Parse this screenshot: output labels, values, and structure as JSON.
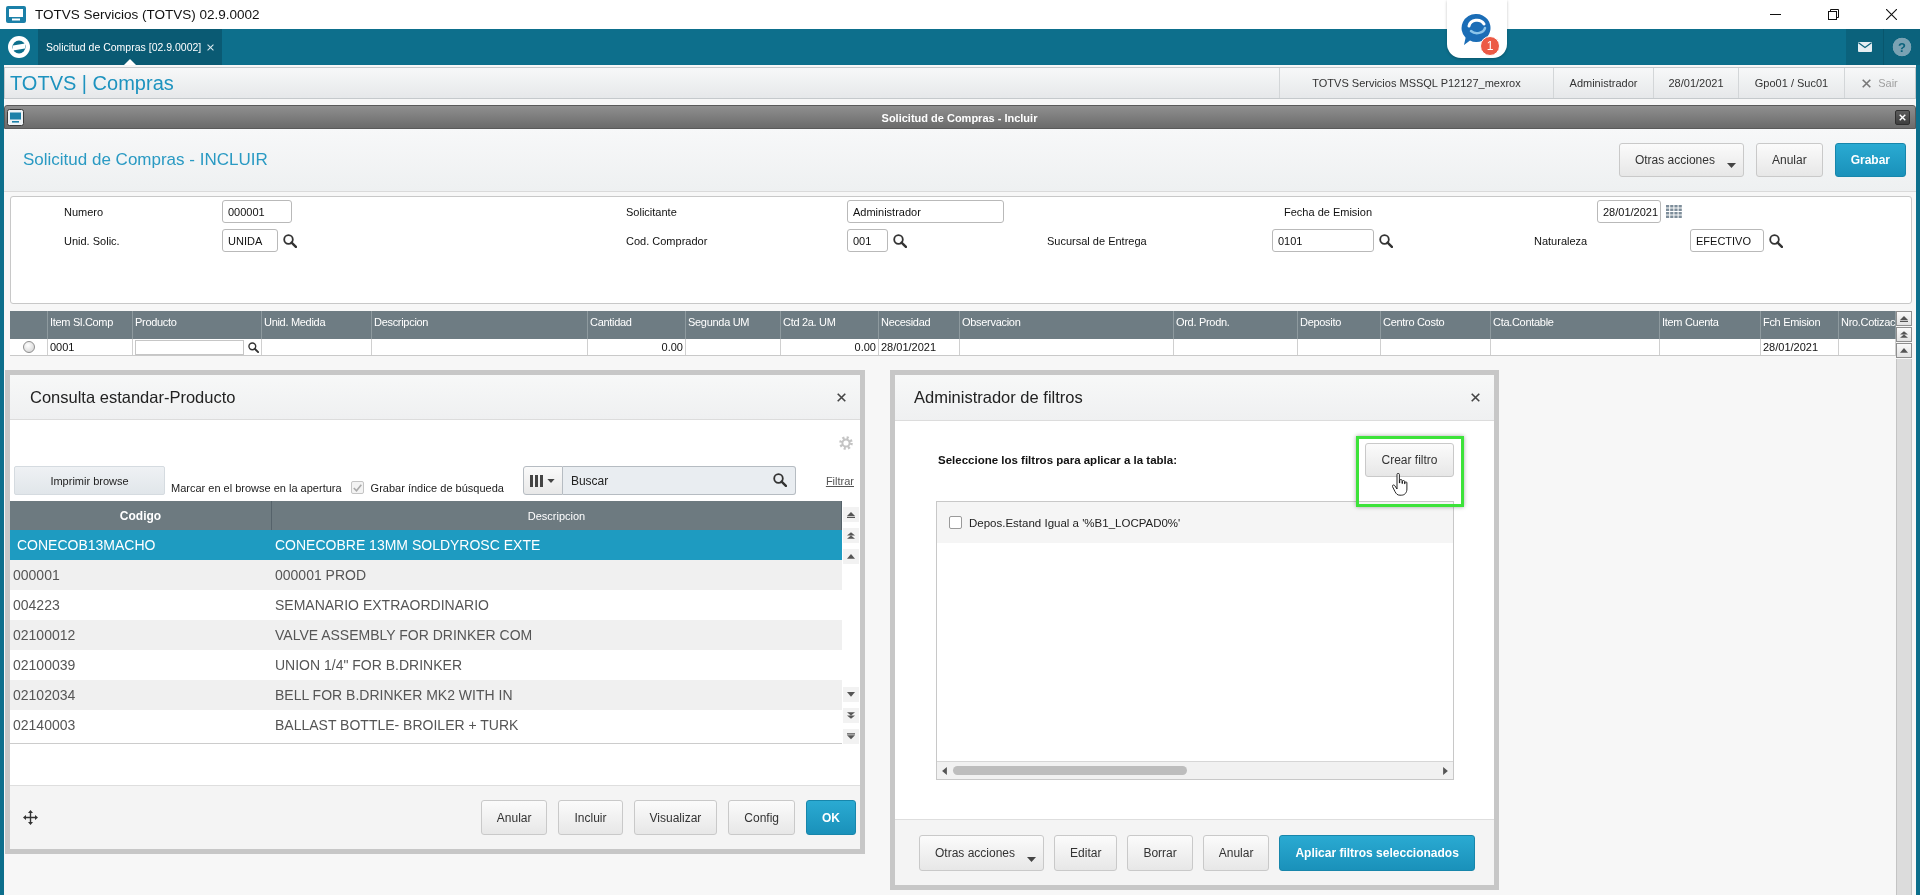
{
  "window": {
    "title": "TOTVS Servicios (TOTVS) 02.9.0002"
  },
  "tab_bar": {
    "tabs": [
      {
        "label": "Solicitud de Compras [02.9.0002]",
        "selected": true
      }
    ],
    "notification_badge": "1",
    "help_button": "?"
  },
  "app_header": {
    "title": "TOTVS | Compras",
    "info": [
      "TOTVS Servicios MSSQL P12127_mexrox",
      "Administrador",
      "28/01/2021",
      "Gpo01 / Suc01"
    ],
    "logout": "Sair"
  },
  "main_window": {
    "title": "Solicitud de Compras - Incluir",
    "heading": "Solicitud de Compras - INCLUIR",
    "buttons": [
      {
        "label": "Otras acciones",
        "kind": "menu"
      },
      {
        "label": "Anular",
        "kind": "plain"
      },
      {
        "label": "Grabar",
        "kind": "primary"
      }
    ]
  },
  "form": {
    "rows": [
      [
        {
          "label": "Numero",
          "value": "000001",
          "kind": "text"
        },
        {
          "label": "Solicitante",
          "value": "Administrador",
          "kind": "text"
        },
        {
          "label": "Fecha de Emision",
          "value": "28/01/2021",
          "kind": "date"
        }
      ],
      [
        {
          "label": "Unid. Solic.",
          "value": "UNIDA",
          "kind": "lookup"
        },
        {
          "label": "Cod. Comprador",
          "value": "001",
          "kind": "lookup"
        },
        {
          "label": "Sucursal de Entrega",
          "value": "0101",
          "kind": "lookup"
        },
        {
          "label": "Naturaleza",
          "value": "EFECTIVO",
          "kind": "lookup"
        }
      ]
    ]
  },
  "grid": {
    "row_selected": false,
    "columns": [
      {
        "heading": "Item Sl.Comp",
        "kind": "text",
        "cell": "0001"
      },
      {
        "heading": "Producto",
        "kind": "lookup"
      },
      {
        "heading": "Unid. Medida",
        "kind": "text"
      },
      {
        "heading": "Descripcion",
        "kind": "text"
      },
      {
        "heading": "Cantidad",
        "kind": "number",
        "cell": "0.00"
      },
      {
        "heading": "Segunda UM",
        "kind": "text"
      },
      {
        "heading": "Ctd 2a. UM",
        "kind": "number",
        "cell": "0.00"
      },
      {
        "heading": "Necesidad",
        "kind": "text",
        "cell": "28/01/2021"
      },
      {
        "heading": "Observacion",
        "kind": "text"
      },
      {
        "heading": "Ord. Prodn.",
        "kind": "text"
      },
      {
        "heading": "Deposito",
        "kind": "text"
      },
      {
        "heading": "Centro Costo",
        "kind": "text"
      },
      {
        "heading": "Cta.Contable",
        "kind": "text"
      },
      {
        "heading": "Item Cuenta",
        "kind": "text"
      },
      {
        "heading": "Fch Emision",
        "kind": "text",
        "cell": "28/01/2021"
      },
      {
        "heading": "Nro.Cotizac",
        "kind": "text"
      }
    ]
  },
  "product_lookup": {
    "title": "Consulta estandar-Producto",
    "print_button": "Imprimir browse",
    "mark_on_open": "Marcar en el browse en la apertura",
    "save_index": {
      "label": "Grabar índice de búsqueda",
      "checked": true,
      "disabled": true
    },
    "search": {
      "placeholder": "Buscar"
    },
    "filter_link": "Filtrar",
    "columns": [
      {
        "label": "Codigo",
        "selected": true
      },
      {
        "label": "Descripcion",
        "selected": false
      }
    ],
    "rows": [
      {
        "selected": true,
        "cells": [
          "CONECOB13MACHO",
          "CONECOBRE 13MM SOLDYROSC EXTE"
        ]
      },
      {
        "selected": false,
        "cells": [
          "000001",
          "000001 PROD"
        ]
      },
      {
        "selected": false,
        "cells": [
          "004223",
          "SEMANARIO EXTRAORDINARIO"
        ]
      },
      {
        "selected": false,
        "cells": [
          "02100012",
          "VALVE ASSEMBLY FOR DRINKER COM"
        ]
      },
      {
        "selected": false,
        "cells": [
          "02100039",
          "UNION 1/4\" FOR B.DRINKER"
        ]
      },
      {
        "selected": false,
        "cells": [
          "02102034",
          "BELL FOR B.DRINKER MK2 WITH IN"
        ]
      },
      {
        "selected": false,
        "cells": [
          "02140003",
          "BALLAST BOTTLE- BROILER + TURK"
        ]
      }
    ],
    "buttons": [
      {
        "label": "Anular",
        "kind": "plain"
      },
      {
        "label": "Incluir",
        "kind": "plain"
      },
      {
        "label": "Visualizar",
        "kind": "plain"
      },
      {
        "label": "Config",
        "kind": "plain"
      },
      {
        "label": "OK",
        "kind": "primary"
      }
    ]
  },
  "filter_manager": {
    "title": "Administrador de filtros",
    "prompt": "Seleccione los filtros para aplicar a la tabla:",
    "create_button": {
      "label": "Crear filtro",
      "highlighted": true
    },
    "filters": [
      {
        "label": "Depos.Estand Igual a '%B1_LOCPAD0%'",
        "checked": false
      }
    ],
    "buttons": [
      {
        "label": "Otras acciones",
        "kind": "menu"
      },
      {
        "label": "Editar",
        "kind": "plain"
      },
      {
        "label": "Borrar",
        "kind": "plain"
      },
      {
        "label": "Anular",
        "kind": "plain"
      },
      {
        "label": "Aplicar filtros seleccionados",
        "kind": "primary"
      }
    ]
  }
}
